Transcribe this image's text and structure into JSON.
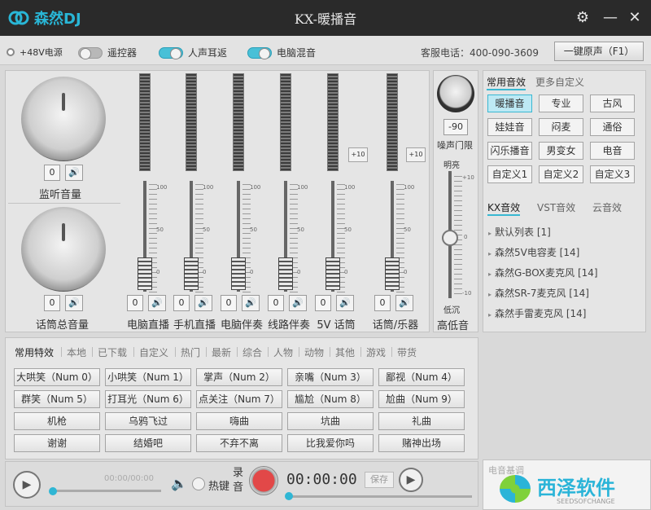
{
  "app": {
    "brand": "森然DJ",
    "title": "KX-暖播音"
  },
  "topbar": {
    "phantom_label": "+48V电源",
    "remote_label": "遥控器",
    "ear_return_label": "人声耳返",
    "pc_mix_label": "电脑混音",
    "phone_label": "客服电话：400-090-3609",
    "restore_label": "一键原声（F1）",
    "remote_on": false,
    "ear_return_on": true,
    "pc_mix_on": true
  },
  "mixer": {
    "monitor": {
      "label": "监听音量",
      "value": "0"
    },
    "master": {
      "label": "话筒总音量",
      "value": "0"
    },
    "channels": [
      {
        "label": "电脑直播",
        "value": "0",
        "plus10": ""
      },
      {
        "label": "手机直播",
        "value": "0",
        "plus10": ""
      },
      {
        "label": "电脑伴奏",
        "value": "0",
        "plus10": ""
      },
      {
        "label": "线路伴奏",
        "value": "0",
        "plus10": ""
      },
      {
        "label": "5V 话筒",
        "value": "0",
        "plus10": "+10"
      },
      {
        "label": "话筒/乐器",
        "value": "0",
        "plus10": "+10"
      }
    ],
    "ticks": [
      "100",
      "50",
      "0"
    ]
  },
  "noise": {
    "value": "-90",
    "label": "噪声门限",
    "bright": "明亮",
    "low": "低沉",
    "bottom_label": "高低音",
    "ticks": [
      "+10",
      "0",
      "-10"
    ]
  },
  "effects": {
    "tabs": [
      "常用音效",
      "更多自定义"
    ],
    "buttons": [
      "暖播音",
      "专业",
      "古风",
      "娃娃音",
      "闷麦",
      "通俗",
      "闪乐播音",
      "男变女",
      "电音",
      "自定义1",
      "自定义2",
      "自定义3"
    ],
    "sub_tabs": [
      "KX音效",
      "VST音效",
      "云音效"
    ],
    "list": [
      "默认列表 [1]",
      "森然5V电容麦 [14]",
      "森然G-BOX麦克风 [14]",
      "森然SR-7麦克风 [14]",
      "森然手雷麦克风 [14]"
    ]
  },
  "sound_fx": {
    "categories": [
      "常用特效",
      "本地",
      "已下载",
      "自定义",
      "热门",
      "最新",
      "综合",
      "人物",
      "动物",
      "其他",
      "游戏",
      "带货"
    ],
    "buttons": [
      "大哄笑（Num 0）",
      "小哄笑（Num 1）",
      "掌声（Num 2）",
      "亲嘴（Num 3）",
      "鄙视（Num 4）",
      "群笑（Num 5）",
      "打耳光（Num 6）",
      "点关注（Num 7）",
      "尴尬（Num 8）",
      "尬曲（Num 9）",
      "机枪",
      "乌鸦飞过",
      "嗨曲",
      "坑曲",
      "礼曲",
      "谢谢",
      "结婚吧",
      "不弃不离",
      "比我爱你吗",
      "赌神出场"
    ]
  },
  "player": {
    "time": "00:00/00:00",
    "hotkey": "热键",
    "record_label": "录音",
    "record_time": "00:00:00",
    "save_label": "保存"
  },
  "watermark": {
    "partial_label": "电音基调",
    "text": "西泽软件",
    "sub": "SEEDSOFCHANGE"
  },
  "colors": {
    "accent": "#39b8d2",
    "titlebar": "#2a2a2a",
    "record": "#e24848"
  }
}
